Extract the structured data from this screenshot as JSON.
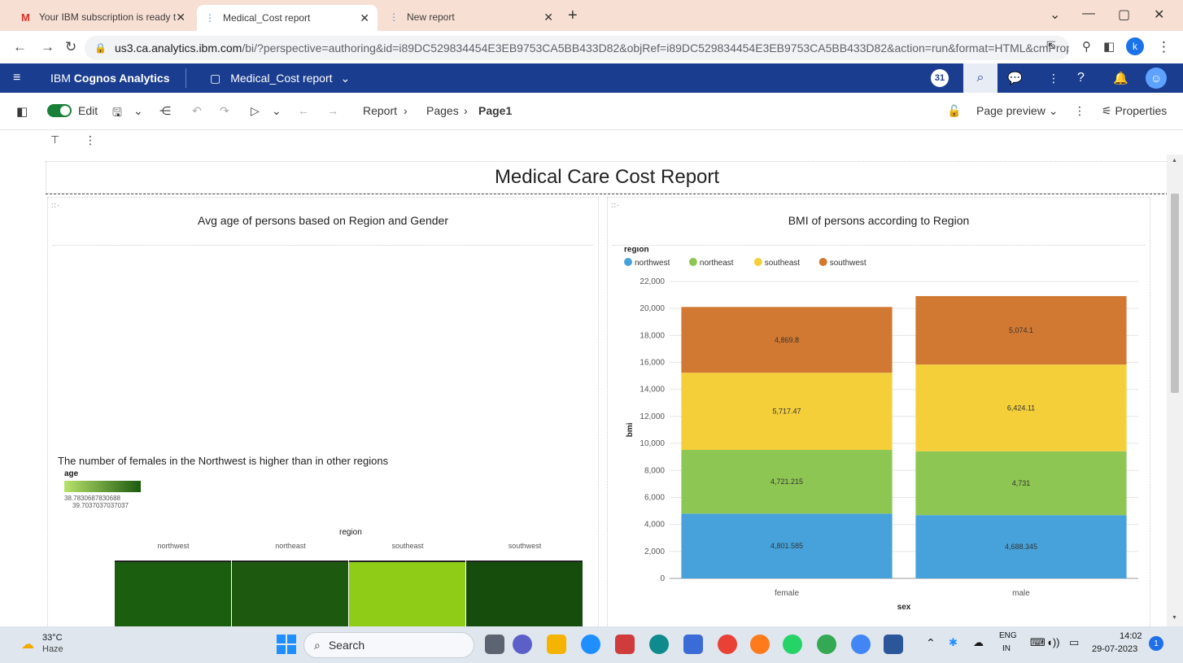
{
  "browser": {
    "tabs": [
      {
        "label": "Your IBM subscription is ready to",
        "icon": "gmail-icon"
      },
      {
        "label": "Medical_Cost report",
        "icon": "cognos-icon"
      },
      {
        "label": "New report",
        "icon": "cognos-icon"
      }
    ],
    "new_tab": "+",
    "url_host": "us3.ca.analytics.ibm.com",
    "url_rest": "/bi/?perspective=authoring&id=i89DC529834454E3EB9753CA5BB433D82&objRef=i89DC529834454E3EB9753CA5BB433D82&action=run&format=HTML&cmPropStr...",
    "profile_initial": "k"
  },
  "cognos": {
    "brand_prefix": "IBM ",
    "brand_name": "Cognos Analytics",
    "report_name": "Medical_Cost report",
    "notification_count": "31",
    "accent": "#1b3d8f"
  },
  "toolbar": {
    "edit_label": "Edit",
    "breadcrumb": [
      "Report",
      "Pages",
      "Page1"
    ],
    "page_preview": "Page preview",
    "properties": "Properties"
  },
  "report": {
    "title": "Medical Care Cost Report",
    "left_panel": {
      "title": "Avg age of persons based on Region and Gender",
      "note": "The number of females in the Northwest is higher than in other regions",
      "legend_title": "age",
      "legend_min": "38.7830687830688",
      "legend_max": "39.7037037037037",
      "column_title": "region",
      "columns": [
        "northwest",
        "northeast",
        "southeast",
        "southwest"
      ],
      "colors": [
        "#1c5e10",
        "#1d5a10",
        "#8fcc18",
        "#164d0c"
      ]
    },
    "right_panel": {
      "title": "BMI of persons according to Region"
    }
  },
  "chart_data": {
    "type": "bar",
    "stacked": true,
    "title": "BMI of persons according to Region",
    "xlabel": "sex",
    "ylabel": "bmi",
    "legend_title": "region",
    "legend_position": "top-left",
    "categories": [
      "female",
      "male"
    ],
    "ylim": [
      0,
      22000
    ],
    "yticks": [
      0,
      2000,
      4000,
      6000,
      8000,
      10000,
      12000,
      14000,
      16000,
      18000,
      20000,
      22000
    ],
    "ytick_labels": [
      "0",
      "2,000",
      "4,000",
      "6,000",
      "8,000",
      "10,000",
      "12,000",
      "14,000",
      "16,000",
      "18,000",
      "20,000",
      "22,000"
    ],
    "grid": true,
    "series": [
      {
        "name": "northwest",
        "color": "#47a2db",
        "values": [
          4801.585,
          4688.345
        ],
        "labels": [
          "4,801.585",
          "4,688.345"
        ]
      },
      {
        "name": "northeast",
        "color": "#8ec653",
        "values": [
          4721.215,
          4731
        ],
        "labels": [
          "4,721.215",
          "4,731"
        ]
      },
      {
        "name": "southeast",
        "color": "#f4cf3a",
        "values": [
          5717.47,
          6424.11
        ],
        "labels": [
          "5,717.47",
          "6,424.11"
        ]
      },
      {
        "name": "southwest",
        "color": "#d17932",
        "values": [
          4869.8,
          5074.1
        ],
        "labels": [
          "4,869.8",
          "5,074.1"
        ]
      }
    ]
  },
  "taskbar": {
    "weather_temp": "33°C",
    "weather_desc": "Haze",
    "search_placeholder": "Search",
    "lang_top": "ENG",
    "lang_bottom": "IN",
    "time": "14:02",
    "date": "29-07-2023",
    "notif_count": "1"
  }
}
